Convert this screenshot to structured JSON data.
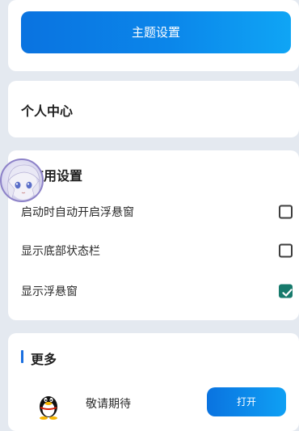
{
  "theme": {
    "button_label": "主题设置"
  },
  "personal": {
    "title": "个人中心"
  },
  "app_settings": {
    "title": "应用设置",
    "items": [
      {
        "label": "启动时自动开启浮悬窗",
        "checked": false
      },
      {
        "label": "显示底部状态栏",
        "checked": false
      },
      {
        "label": "显示浮悬窗",
        "checked": true
      }
    ]
  },
  "more": {
    "title": "更多",
    "app": {
      "name": "敬请期待",
      "icon": "qq-penguin-icon",
      "button_label": "打开"
    }
  },
  "colors": {
    "accent": "#0a73e0",
    "checkbox_on": "#177a6c",
    "background": "#e4e9f0"
  }
}
